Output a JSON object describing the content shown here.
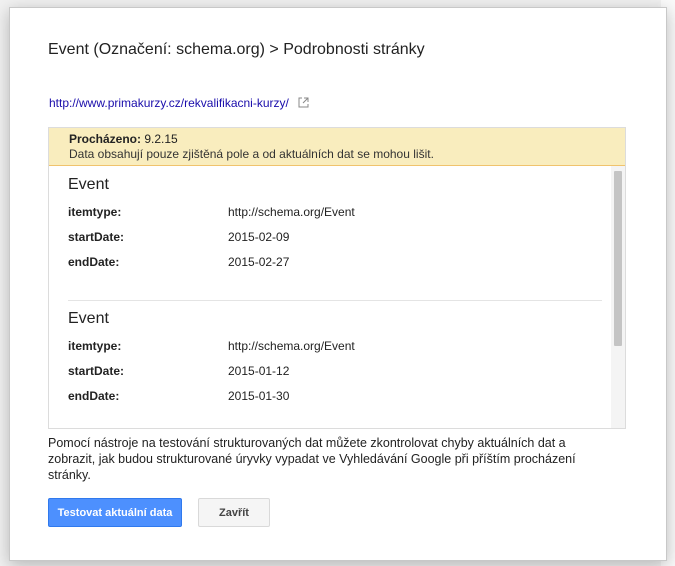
{
  "dialog": {
    "title": "Event (Označení: schema.org) > Podrobnosti stránky",
    "url": "http://www.primakurzy.cz/rekvalifikacni-kurzy/",
    "notice": {
      "crawled_label": "Procházeno:",
      "crawled_date": "9.2.15",
      "message": "Data obsahují pouze zjištěná pole a od aktuálních dat se mohou lišit."
    },
    "items": [
      {
        "title": "Event",
        "fields": [
          {
            "key": "itemtype:",
            "value": "http://schema.org/Event"
          },
          {
            "key": "startDate:",
            "value": "2015-02-09"
          },
          {
            "key": "endDate:",
            "value": "2015-02-27"
          }
        ]
      },
      {
        "title": "Event",
        "fields": [
          {
            "key": "itemtype:",
            "value": "http://schema.org/Event"
          },
          {
            "key": "startDate:",
            "value": "2015-01-12"
          },
          {
            "key": "endDate:",
            "value": "2015-01-30"
          }
        ]
      }
    ],
    "info": "Pomocí nástroje na testování strukturovaných dat můžete zkontrolovat chyby aktuálních dat a zobrazit, jak budou strukturované úryvky vypadat ve Vyhledávání Google při příštím procházení stránky.",
    "buttons": {
      "test_label": "Testovat aktuální data",
      "close_label": "Zavřít"
    }
  },
  "icons": {
    "external_link": "external-link-icon"
  },
  "colors": {
    "notice_bg": "#f9edbe",
    "primary_button": "#4d90fe",
    "link": "#1a0dab"
  }
}
